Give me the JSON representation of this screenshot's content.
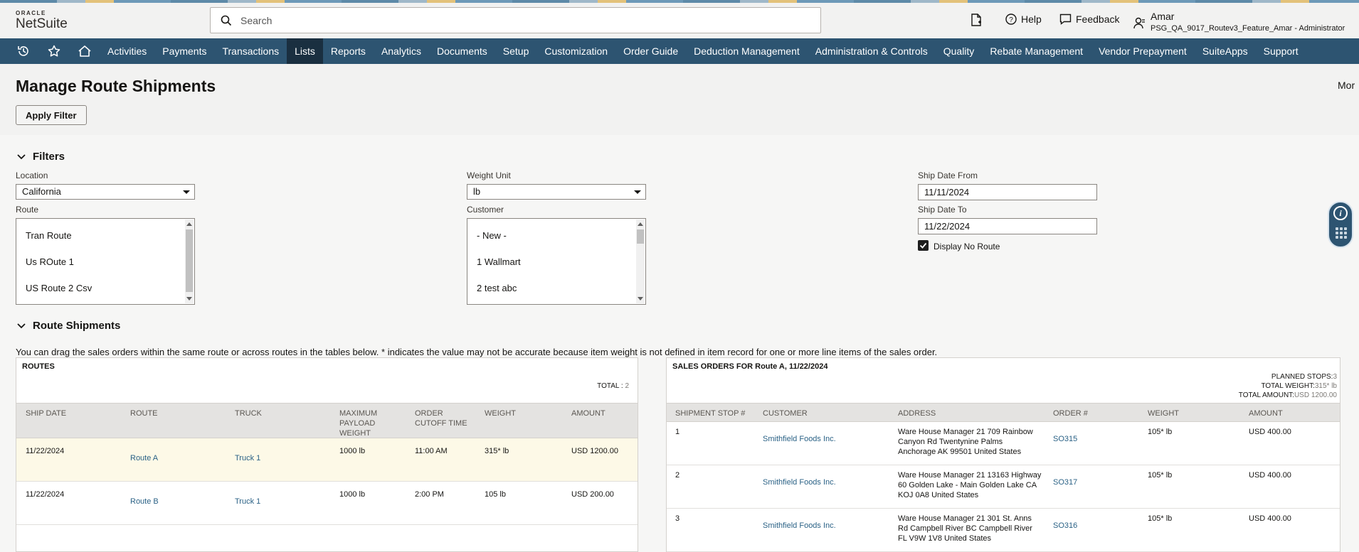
{
  "header": {
    "logo_top": "ORACLE",
    "logo_bottom": "NetSuite",
    "search_placeholder": "Search",
    "help_label": "Help",
    "feedback_label": "Feedback",
    "user_name": "Amar",
    "user_role": "PSG_QA_9017_Routev3_Feature_Amar - Administrator"
  },
  "nav": {
    "items": [
      "Activities",
      "Payments",
      "Transactions",
      "Lists",
      "Reports",
      "Analytics",
      "Documents",
      "Setup",
      "Customization",
      "Order Guide",
      "Deduction Management",
      "Administration & Controls",
      "Quality",
      "Rebate Management",
      "Vendor Prepayment",
      "SuiteApps",
      "Support"
    ],
    "active": "Lists"
  },
  "page": {
    "title": "Manage Route Shipments",
    "more_label": "Mor",
    "apply_filter_label": "Apply Filter"
  },
  "filters": {
    "section_title": "Filters",
    "location_label": "Location",
    "location_value": "California",
    "weight_unit_label": "Weight Unit",
    "weight_unit_value": "lb",
    "ship_date_from_label": "Ship Date From",
    "ship_date_from_value": "11/11/2024",
    "ship_date_to_label": "Ship Date To",
    "ship_date_to_value": "11/22/2024",
    "route_label": "Route",
    "route_options": [
      "Tran Route",
      "Us ROute 1",
      "US Route 2 Csv"
    ],
    "customer_label": "Customer",
    "customer_options": [
      "- New -",
      "1 Wallmart",
      "2 test abc"
    ],
    "display_no_route_label": "Display No Route",
    "display_no_route_checked": true
  },
  "route_shipments": {
    "section_title": "Route Shipments",
    "info": "You can drag the sales orders within the same route or across routes in the tables below. * indicates the value may not be accurate because item weight is not defined in item record for one or more line items of the sales order."
  },
  "routes_table": {
    "title": "ROUTES",
    "total_label": "TOTAL :",
    "total_value": "2",
    "headers": [
      "SHIP DATE",
      "ROUTE",
      "TRUCK",
      "MAXIMUM PAYLOAD WEIGHT",
      "ORDER CUTOFF TIME",
      "WEIGHT",
      "AMOUNT"
    ],
    "rows": [
      {
        "ship_date": "11/22/2024",
        "route": "Route A",
        "truck": "Truck 1",
        "max_payload": "1000 lb",
        "cutoff": "11:00 AM",
        "weight": "315* lb",
        "amount": "USD 1200.00"
      },
      {
        "ship_date": "11/22/2024",
        "route": "Route B",
        "truck": "Truck 1",
        "max_payload": "1000 lb",
        "cutoff": "2:00 PM",
        "weight": "105 lb",
        "amount": "USD 200.00"
      }
    ]
  },
  "sales_orders_table": {
    "title": "SALES ORDERS FOR Route A, 11/22/2024",
    "planned_stops_label": "PLANNED STOPS:",
    "planned_stops_value": "3",
    "total_weight_label": "TOTAL WEIGHT:",
    "total_weight_value": "315* lb",
    "total_amount_label": "TOTAL AMOUNT:",
    "total_amount_value": "USD 1200.00",
    "headers": [
      "SHIPMENT STOP #",
      "CUSTOMER",
      "ADDRESS",
      "ORDER #",
      "WEIGHT",
      "AMOUNT"
    ],
    "rows": [
      {
        "stop": "1",
        "customer": "Smithfield Foods Inc.",
        "address": [
          "Ware House Manager 21 709 Rainbow",
          "Canyon Rd Twentynine Palms",
          "Anchorage AK 99501 United States"
        ],
        "order": "SO315",
        "weight": "105* lb",
        "amount": "USD 400.00"
      },
      {
        "stop": "2",
        "customer": "Smithfield Foods Inc.",
        "address": [
          "Ware House Manager 21 13163 Highway",
          "60 Golden Lake - Main Golden Lake CA",
          "KOJ 0A8 United States"
        ],
        "order": "SO317",
        "weight": "105* lb",
        "amount": "USD 400.00"
      },
      {
        "stop": "3",
        "customer": "Smithfield Foods Inc.",
        "address": [
          "Ware House Manager 21 301 St. Anns",
          "Rd Campbell River BC Campbell River",
          "FL V9W 1V8 United States"
        ],
        "order": "SO316",
        "weight": "105* lb",
        "amount": "USD 400.00"
      }
    ]
  },
  "colors": {
    "nav_bg": "#2d5471",
    "nav_active": "#1a2f40",
    "link": "#2b6286",
    "selected_row": "#fdf9e7"
  },
  "icons": [
    "recent-icon",
    "star-icon",
    "home-icon",
    "search-icon",
    "new-document-icon",
    "help-icon",
    "feedback-icon",
    "user-icon",
    "chevron-down-icon",
    "checkbox-check-icon",
    "info-icon",
    "grid-icon"
  ]
}
